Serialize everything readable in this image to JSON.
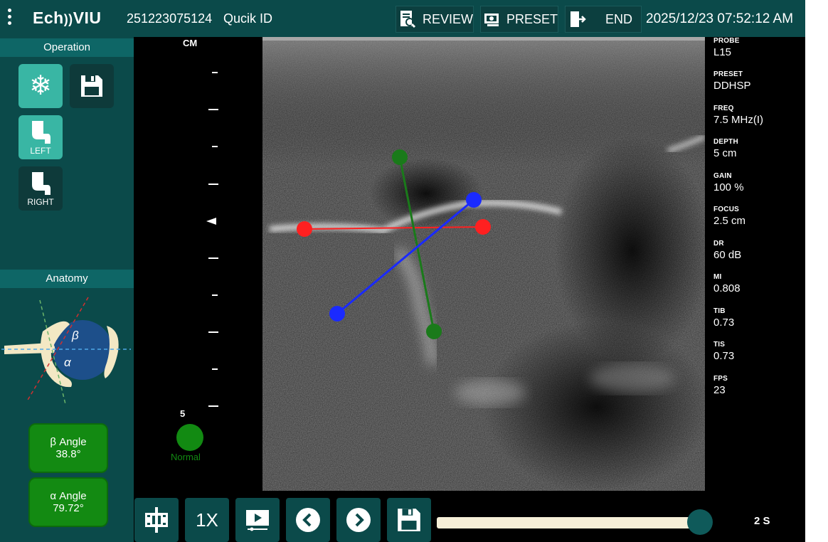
{
  "topbar": {
    "logo": "Ech",
    "logo_mark": "))",
    "logo_rest": "VIU",
    "patient_id": "251223075124",
    "quick_id": "Qucik ID",
    "review_label": "REVIEW",
    "preset_label": "PRESET",
    "end_label": "END",
    "datetime": "2025/12/23 07:52:12 AM"
  },
  "operation": {
    "title": "Operation",
    "left_label": "LEFT",
    "right_label": "RIGHT"
  },
  "anatomy": {
    "title": "Anatomy",
    "beta_symbol": "β",
    "alpha_symbol": "α"
  },
  "angles": {
    "beta_label": "β Angle",
    "beta_value": "38.8°",
    "alpha_label": "α Angle",
    "alpha_value": "79.72°"
  },
  "ruler": {
    "unit": "CM",
    "max_depth": "5",
    "status": "Normal",
    "status_color": "#128a12"
  },
  "params": [
    {
      "key": "PROBE",
      "value": "L15"
    },
    {
      "key": "PRESET",
      "value": "DDHSP"
    },
    {
      "key": "FREQ",
      "value": "7.5 MHz(I)"
    },
    {
      "key": "DEPTH",
      "value": "5 cm"
    },
    {
      "key": "GAIN",
      "value": "100 %"
    },
    {
      "key": "FOCUS",
      "value": "2.5 cm"
    },
    {
      "key": "DR",
      "value": "60 dB"
    },
    {
      "key": "MI",
      "value": "0.808"
    },
    {
      "key": "TIB",
      "value": "0.73"
    },
    {
      "key": "TIS",
      "value": "0.73"
    },
    {
      "key": "FPS",
      "value": "23"
    }
  ],
  "bottombar": {
    "speed_label": "1X",
    "slider_value": "2 S"
  },
  "colors": {
    "panel": "#0b4a4a",
    "accent": "#39b6a4",
    "baseline": "#ff2020",
    "alpha_line": "#1a7a1a",
    "beta_line": "#1a2aff"
  }
}
